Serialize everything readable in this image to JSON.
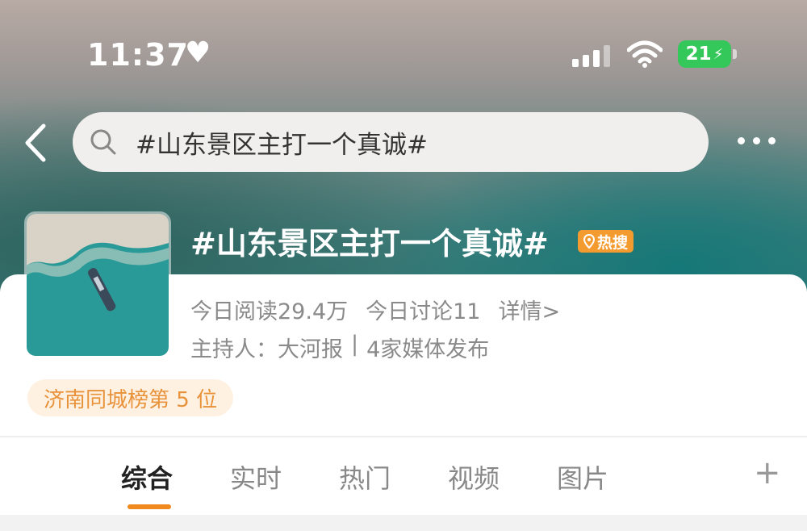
{
  "status_bar": {
    "time": "11:37",
    "battery": "21"
  },
  "search": {
    "query": "#山东景区主打一个真诚#"
  },
  "topic": {
    "title": "#山东景区主打一个真诚#",
    "badge": "热搜",
    "reads": "今日阅读29.4万",
    "discussions": "今日讨论11",
    "details_link": "详情>",
    "host_label": "主持人：",
    "host_name": "大河报",
    "separator": "|",
    "media": "4家媒体发布",
    "rank": "济南同城榜第 5 位"
  },
  "tabs": [
    {
      "label": "综合"
    },
    {
      "label": "实时"
    },
    {
      "label": "热门"
    },
    {
      "label": "视频"
    },
    {
      "label": "图片"
    }
  ],
  "colors": {
    "accent": "#f08a1f",
    "hot_badge": "#f49b2f",
    "battery_green": "#34c759"
  },
  "icons": [
    "heart-icon",
    "signal-icon",
    "wifi-icon",
    "battery-icon",
    "back-icon",
    "search-icon",
    "more-icon",
    "location-pin-icon",
    "plus-icon"
  ]
}
